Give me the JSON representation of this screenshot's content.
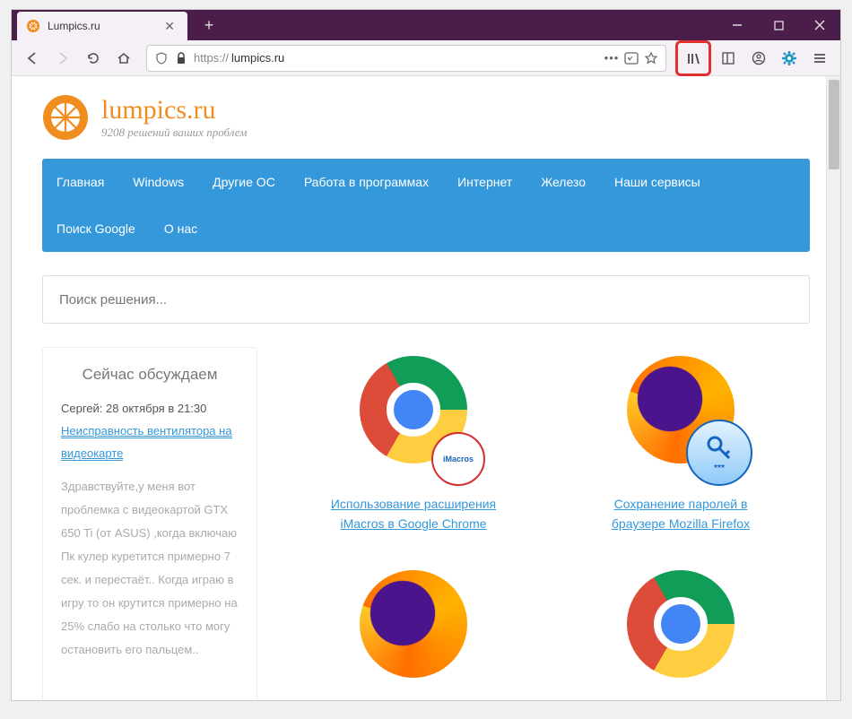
{
  "tab": {
    "title": "Lumpics.ru"
  },
  "url": {
    "protocol": "https://",
    "host": "lumpics.ru"
  },
  "site": {
    "name": "lumpics.ru",
    "tagline": "9208 решений ваших проблем"
  },
  "nav": {
    "items": [
      "Главная",
      "Windows",
      "Другие ОС",
      "Работа в программах",
      "Интернет",
      "Железо",
      "Наши сервисы",
      "Поиск Google",
      "О нас"
    ]
  },
  "search": {
    "placeholder": "Поиск решения..."
  },
  "sidebar": {
    "heading": "Сейчас обсуждаем",
    "comment": {
      "author_date": "Сергей: 28 октября в 21:30",
      "link": "Неисправность вентилятора на видеокарте",
      "body": "Здравствуйте,у меня вот проблемка с видеокартой GTX 650 Ti (от ASUS) ,когда включаю Пк кулер куретится примерно 7 сек. и перестаёт.. Когда играю в игру то он крутится примерно на 25% слабо на столько что могу остановить его пальцем.."
    }
  },
  "articles": [
    {
      "title": "Использование расширения iMacros в Google Chrome",
      "badge": "iMacros"
    },
    {
      "title": "Сохранение паролей в браузере Mozilla Firefox",
      "badge_pass": "***"
    }
  ]
}
